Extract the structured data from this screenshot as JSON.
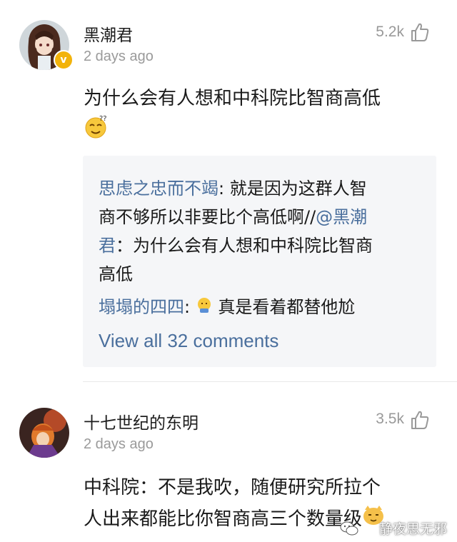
{
  "comments": [
    {
      "username": "黑潮君",
      "time": "2 days ago",
      "likes": "5.2k",
      "text_line1": "为什么会有人想和中科院比智商高低",
      "verified_mark": "v",
      "avatar_icon": "anime-girl-avatar",
      "emoji": "thinking-face-emoji",
      "replies": [
        {
          "user": "思虑之忠而不竭",
          "sep": ":",
          "line1": " 就是因为这群人智",
          "line2_pre": "商不够所以非要比个高低啊//",
          "mention": "@黑潮",
          "line3_mention": "君",
          "line3": "：为什么会有人想和中科院比智商",
          "line4": "高低"
        },
        {
          "user": "塌塌的四四",
          "sep": ":",
          "text": " 真是看着都替他尬",
          "emoji": "embarrassed-emoji"
        }
      ],
      "view_all": "View all 32 comments"
    },
    {
      "username": "十七世纪的东明",
      "time": "2 days ago",
      "likes": "3.5k",
      "text_line1": "中科院：不是我吹，随便研究所拉个",
      "text_line2": "人出来都能比你智商高三个数量级",
      "avatar_icon": "autumn-character-avatar",
      "emoji": "cat-face-emoji"
    }
  ],
  "watermark": "静夜思无邪",
  "colors": {
    "link": "#4a6f9d",
    "reply_bg": "#f5f6f8",
    "meta": "#9a9a9a",
    "badge": "#f2b30b"
  }
}
